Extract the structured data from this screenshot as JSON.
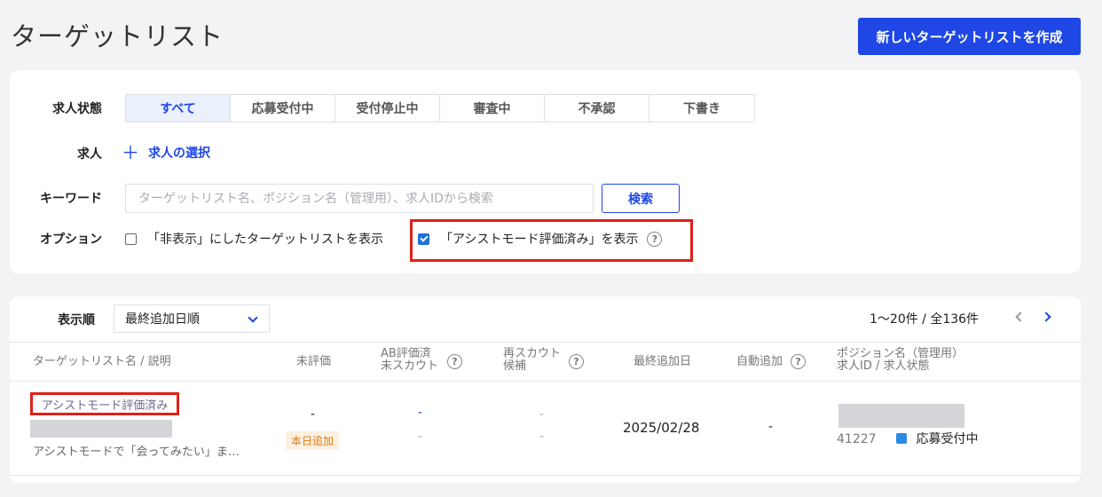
{
  "header": {
    "title": "ターゲットリスト",
    "create_label": "新しいターゲットリストを作成"
  },
  "filters": {
    "status_label": "求人状態",
    "status_tabs": [
      "すべて",
      "応募受付中",
      "受付停止中",
      "審査中",
      "不承認",
      "下書き"
    ],
    "job_label": "求人",
    "job_select_label": "求人の選択",
    "keyword_label": "キーワード",
    "keyword_placeholder": "ターゲットリスト名、ポジション名（管理用）、求人IDから検索",
    "keyword_value": "",
    "search_label": "検索",
    "options_label": "オプション",
    "option_hidden_label": "「非表示」にしたターゲットリストを表示",
    "option_hidden_checked": false,
    "option_assist_label": "「アシストモード評価済み」を表示",
    "option_assist_checked": true
  },
  "list": {
    "sort_label": "表示順",
    "sort_value": "最終追加日順",
    "pagination": "1〜20件 / 全136件",
    "columns": {
      "name": "ターゲットリスト名 / 説明",
      "unrated": "未評価",
      "ab_1": "AB評価済",
      "ab_2": "未スカウト",
      "rescout_1": "再スカウト",
      "rescout_2": "候補",
      "last_added": "最終追加日",
      "auto_add": "自動追加",
      "position_1": "ポジション名（管理用）",
      "position_2": "求人ID / 求人状態"
    },
    "rows": [
      {
        "tag": "アシストモード評価済み",
        "description": "アシストモードで「会ってみたい」ま…",
        "unrated": "-",
        "today_badge": "本日追加",
        "ab_top": "-",
        "ab_bottom": "-",
        "rescout_top": "-",
        "rescout_bottom": "-",
        "last_added": "2025/02/28",
        "auto_add": "-",
        "job_id": "41227",
        "job_status": "応募受付中",
        "status_color": "#2a8ae0"
      }
    ]
  },
  "colors": {
    "accent": "#1e47e5",
    "highlight": "#e0201a",
    "badge_bg": "#fdf0e0",
    "badge_text": "#e07b10"
  }
}
